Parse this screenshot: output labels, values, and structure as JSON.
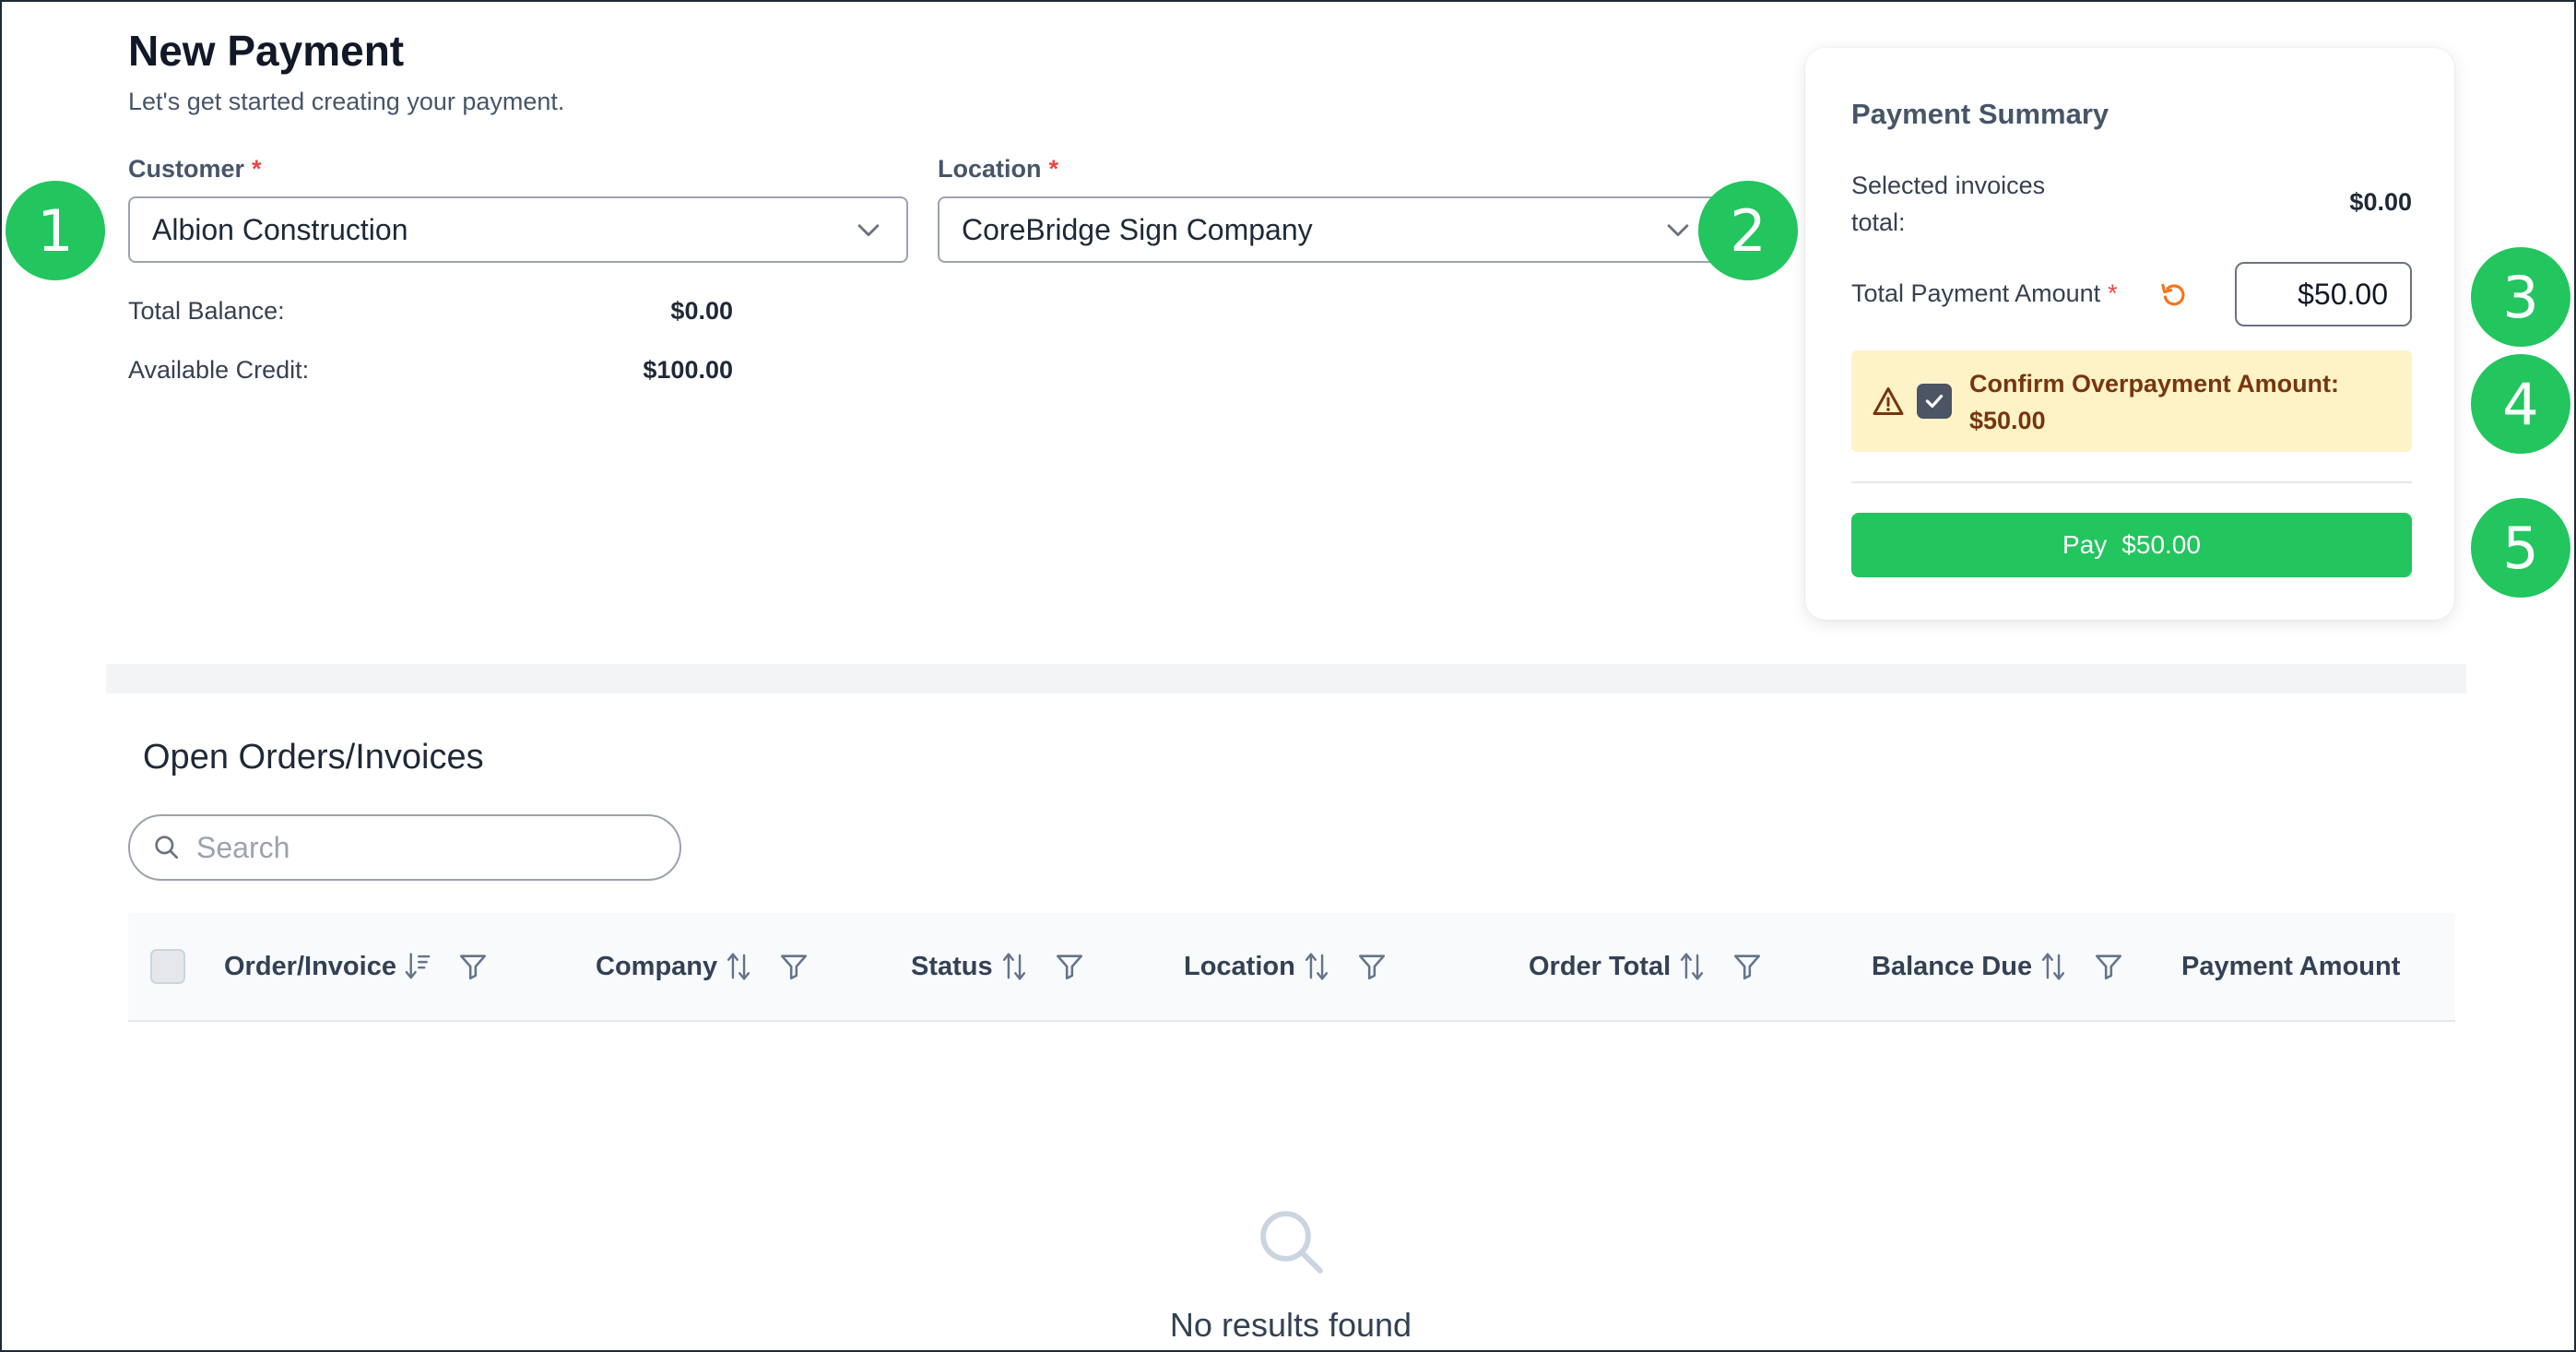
{
  "header": {
    "title": "New Payment",
    "subtitle": "Let's get started creating your payment."
  },
  "customer": {
    "label": "Customer",
    "required_mark": "*",
    "value": "Albion Construction"
  },
  "location": {
    "label": "Location",
    "required_mark": "*",
    "value": "CoreBridge Sign Company"
  },
  "balances": {
    "total_balance_label": "Total Balance:",
    "total_balance_value": "$0.00",
    "available_credit_label": "Available Credit:",
    "available_credit_value": "$100.00"
  },
  "summary": {
    "title": "Payment Summary",
    "selected_label_line1": "Selected invoices",
    "selected_label_line2": "total:",
    "selected_value": "$0.00",
    "total_payment_label": "Total Payment Amount",
    "required_mark": "*",
    "total_payment_value": "$50.00",
    "warning_line1": "Confirm Overpayment Amount:",
    "warning_line2": "$50.00",
    "pay_label": "Pay",
    "pay_amount": "$50.00"
  },
  "callouts": [
    "1",
    "2",
    "3",
    "4",
    "5"
  ],
  "orders": {
    "title": "Open Orders/Invoices",
    "search_placeholder": "Search",
    "columns": [
      "Order/Invoice",
      "Company",
      "Status",
      "Location",
      "Order Total",
      "Balance Due",
      "Payment Amount"
    ],
    "empty_message": "No results found"
  },
  "colors": {
    "accent_green": "#22c55e",
    "warning_bg": "#fef3c7",
    "warning_text": "#78350f",
    "required_red": "#ef4444"
  }
}
